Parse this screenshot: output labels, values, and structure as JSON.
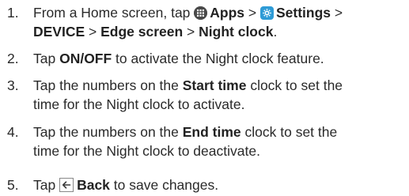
{
  "steps": [
    {
      "number": "1.",
      "line1": {
        "t1": "From a Home screen, tap ",
        "apps": "Apps",
        "t2": " > ",
        "settings": "Settings",
        "t3": " >"
      },
      "line2": {
        "device": "DEVICE",
        "sep1": " > ",
        "edge": "Edge screen",
        "sep2": " > ",
        "night": "Night clock",
        "end": "."
      },
      "icons": [
        "apps-icon",
        "settings-icon"
      ]
    },
    {
      "number": "2.",
      "line1": {
        "t1": "Tap ",
        "b1": "ON/OFF",
        "t2": " to activate the Night clock feature."
      }
    },
    {
      "number": "3.",
      "line1": {
        "t1": "Tap the numbers on the ",
        "b1": "Start time",
        "t2": " clock to set the"
      },
      "line2": {
        "text": "time for the Night clock to activate."
      }
    },
    {
      "number": "4.",
      "line1": {
        "t1": "Tap the numbers on the ",
        "b1": "End time",
        "t2": " clock to set the"
      },
      "line2": {
        "text": "time for the Night clock to deactivate."
      }
    },
    {
      "number": "5.",
      "line1": {
        "t1": "Tap ",
        "b1": "Back",
        "t2": " to save changes."
      },
      "icons": [
        "back-icon"
      ]
    }
  ],
  "colors": {
    "text": "#2a2a2a",
    "settings_icon": "#2e9bd6",
    "back_icon": "#3a3a3a"
  }
}
